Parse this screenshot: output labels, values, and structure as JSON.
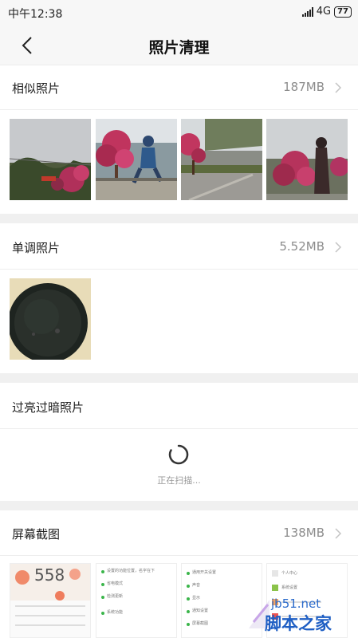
{
  "status_bar": {
    "time": "中午12:38",
    "network": "4G",
    "battery": "77"
  },
  "nav": {
    "title": "照片清理"
  },
  "sections": {
    "similar": {
      "title": "相似照片",
      "size": "187MB"
    },
    "monotone": {
      "title": "单调照片",
      "size": "5.52MB"
    },
    "exposure": {
      "title": "过亮过暗照片",
      "status": "正在扫描..."
    },
    "screenshots": {
      "title": "屏幕截图",
      "size": "138MB"
    }
  },
  "screenshot_thumbs": {
    "s1": {
      "big": "558"
    },
    "s2": {
      "line1": "设置的功能位置，名字在下",
      "line2": "省电模式",
      "line3": "检测更新",
      "line4": "系统功能"
    },
    "s3": {
      "line1": "通用开关设置",
      "line2": "声音",
      "line3": "显示",
      "line4": "通知设置",
      "line5": "屏幕截图"
    },
    "s4": {
      "line1": "个人中心",
      "line2": "系统设置"
    }
  },
  "watermark": {
    "url": "jb51.net",
    "name": "脚本之家"
  },
  "colors": {
    "accent": "#1f5fc4",
    "muted": "#8c8c8c",
    "separator": "#f0f0f0"
  }
}
